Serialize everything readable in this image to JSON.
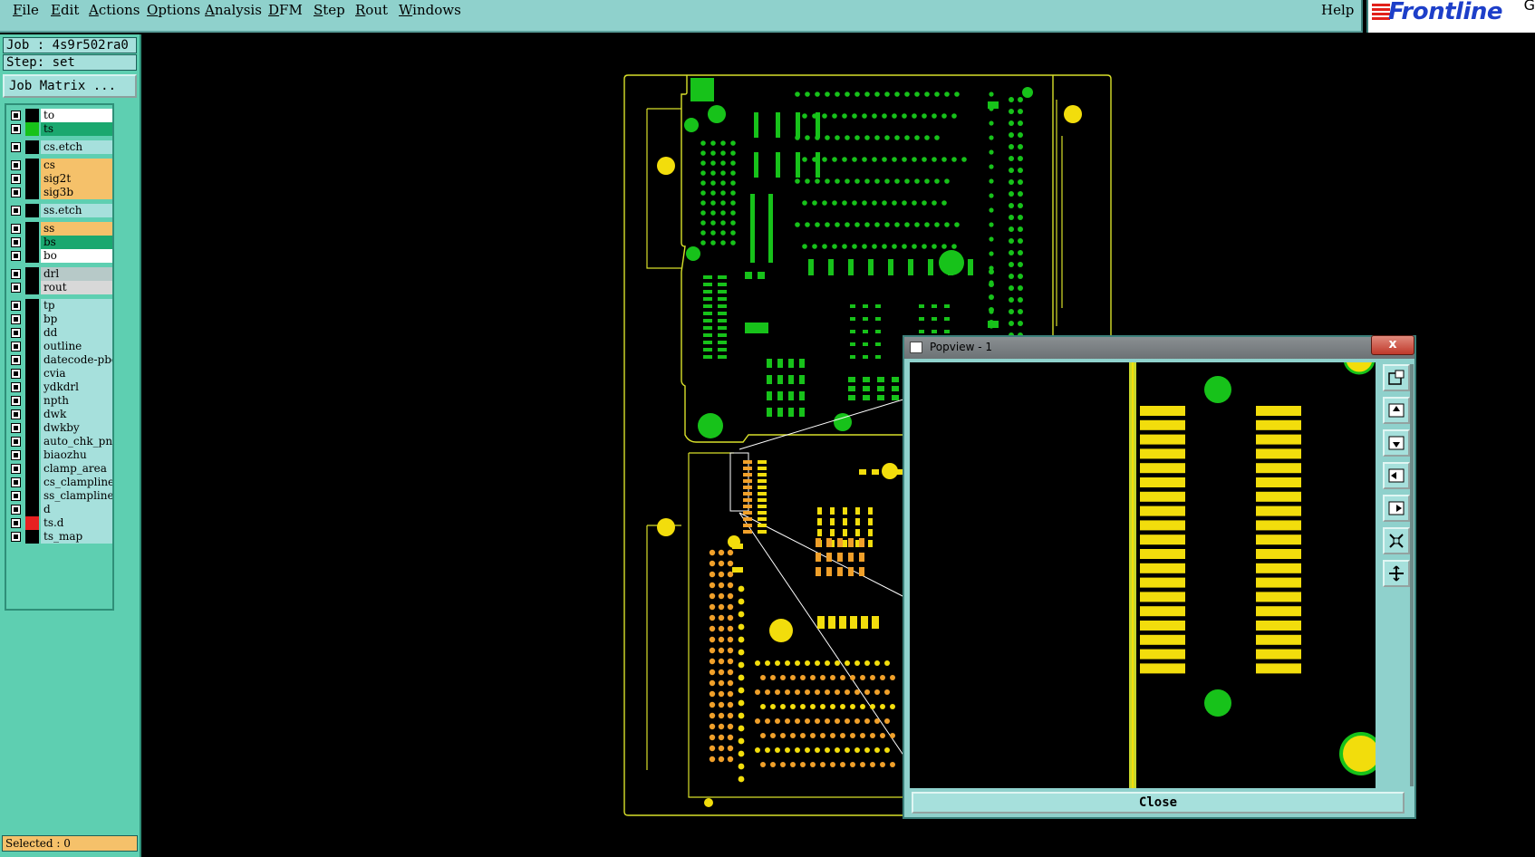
{
  "menu": {
    "items": [
      "File",
      "Edit",
      "Actions",
      "Options",
      "Analysis",
      "DFM",
      "Step",
      "Rout",
      "Windows"
    ],
    "help": "Help"
  },
  "logo": {
    "text": "Frontline",
    "extra": "G"
  },
  "job": {
    "job_label": "Job : 4s9r502ra0",
    "step_label": "Step: set",
    "matrix_button": "Job Matrix ..."
  },
  "layers": [
    {
      "name": "to",
      "bg": "#ffffff",
      "swatch": "#000000"
    },
    {
      "name": "ts",
      "bg": "#1aa86f",
      "swatch": "#17c21a"
    },
    {
      "name": "cs.etch",
      "bg": "#a6e0dc",
      "swatch": "#000000"
    },
    {
      "name": "cs",
      "bg": "#f5c16a",
      "swatch": "#000000"
    },
    {
      "name": "sig2t",
      "bg": "#f5c16a",
      "swatch": "#000000"
    },
    {
      "name": "sig3b",
      "bg": "#f5c16a",
      "swatch": "#000000"
    },
    {
      "name": "ss.etch",
      "bg": "#a6e0dc",
      "swatch": "#000000"
    },
    {
      "name": "ss",
      "bg": "#f5c16a",
      "swatch": "#000000"
    },
    {
      "name": "bs",
      "bg": "#1aa86f",
      "swatch": "#000000"
    },
    {
      "name": "bo",
      "bg": "#ffffff",
      "swatch": "#000000"
    },
    {
      "name": "drl",
      "bg": "#b7c9c8",
      "swatch": "#000000"
    },
    {
      "name": "rout",
      "bg": "#d8d8d8",
      "swatch": "#000000"
    },
    {
      "name": "tp",
      "bg": "#a6e0dc",
      "swatch": "#000000"
    },
    {
      "name": "bp",
      "bg": "#a6e0dc",
      "swatch": "#000000"
    },
    {
      "name": "dd",
      "bg": "#a6e0dc",
      "swatch": "#000000"
    },
    {
      "name": "outline",
      "bg": "#a6e0dc",
      "swatch": "#000000"
    },
    {
      "name": "datecode-pbe",
      "bg": "#a6e0dc",
      "swatch": "#000000"
    },
    {
      "name": "cvia",
      "bg": "#a6e0dc",
      "swatch": "#000000"
    },
    {
      "name": "ydkdrl",
      "bg": "#a6e0dc",
      "swatch": "#000000"
    },
    {
      "name": "npth",
      "bg": "#a6e0dc",
      "swatch": "#000000"
    },
    {
      "name": "dwk",
      "bg": "#a6e0dc",
      "swatch": "#000000"
    },
    {
      "name": "dwkby",
      "bg": "#a6e0dc",
      "swatch": "#000000"
    },
    {
      "name": "auto_chk_pnl",
      "bg": "#a6e0dc",
      "swatch": "#000000"
    },
    {
      "name": "biaozhu",
      "bg": "#a6e0dc",
      "swatch": "#000000"
    },
    {
      "name": "clamp_area",
      "bg": "#a6e0dc",
      "swatch": "#000000"
    },
    {
      "name": "cs_clampline",
      "bg": "#a6e0dc",
      "swatch": "#000000"
    },
    {
      "name": "ss_clampline",
      "bg": "#a6e0dc",
      "swatch": "#000000"
    },
    {
      "name": "d",
      "bg": "#a6e0dc",
      "swatch": "#000000"
    },
    {
      "name": "ts.d",
      "bg": "#a6e0dc",
      "swatch": "#e82020"
    },
    {
      "name": "ts_map",
      "bg": "#a6e0dc",
      "swatch": "#000000"
    }
  ],
  "status": {
    "selected": "Selected : 0"
  },
  "popview": {
    "title": "Popview - 1",
    "close_x": "x",
    "close_button": "Close"
  },
  "colors": {
    "menu_bg": "#8fd1cc",
    "panel_bg": "#5ecfb1",
    "board_outline": "#d8e02a",
    "pad_green": "#17c21a",
    "pad_yellow": "#f2dd0c",
    "pad_orange": "#f0a02a"
  }
}
